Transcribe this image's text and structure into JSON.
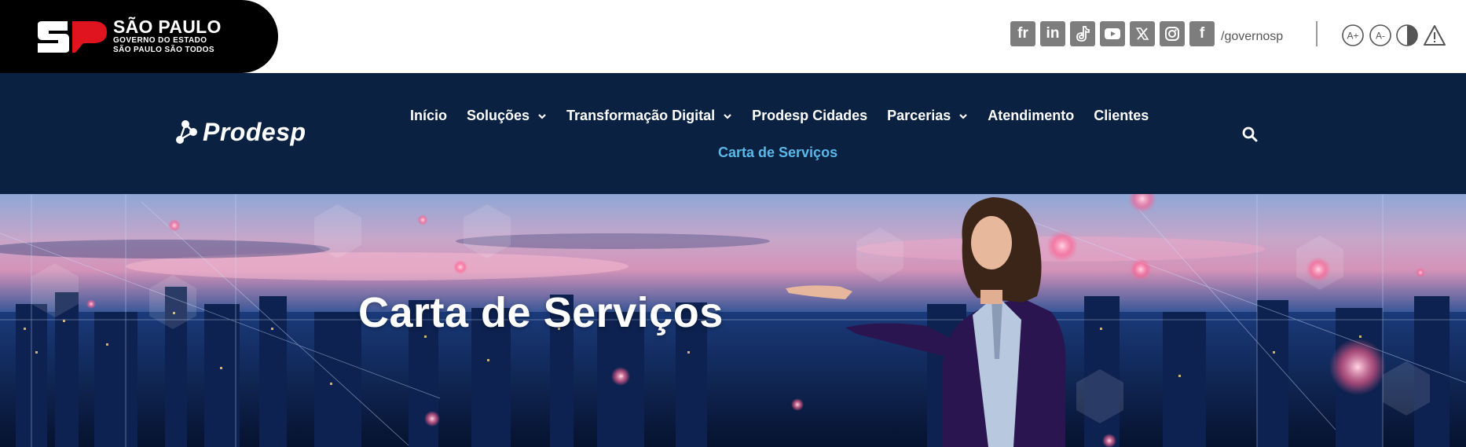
{
  "gov": {
    "title": "SÃO PAULO",
    "line2": "GOVERNO DO ESTADO",
    "line3": "SÃO PAULO SÃO TODOS",
    "brand_red": "#e0141e"
  },
  "social": {
    "icons": [
      "flickr-icon",
      "linkedin-icon",
      "tiktok-icon",
      "youtube-icon",
      "x-icon",
      "instagram-icon",
      "facebook-icon"
    ],
    "flickr_label": "fr",
    "linkedin_label": "in",
    "facebook_label": "f",
    "handle": "/governosp"
  },
  "accessibility": {
    "icons": [
      "increase-font-icon",
      "decrease-font-icon",
      "contrast-icon",
      "alert-icon"
    ]
  },
  "nav": {
    "brand": "Prodesp",
    "items": [
      {
        "label": "Início",
        "dropdown": false
      },
      {
        "label": "Soluções",
        "dropdown": true
      },
      {
        "label": "Transformação Digital",
        "dropdown": true
      },
      {
        "label": "Prodesp Cidades",
        "dropdown": false
      },
      {
        "label": "Parcerias",
        "dropdown": true
      },
      {
        "label": "Atendimento",
        "dropdown": false
      },
      {
        "label": "Clientes",
        "dropdown": false
      }
    ],
    "active": "Carta de Serviços",
    "bg": "#0a2141",
    "active_color": "#5bb8e8"
  },
  "hero": {
    "title": "Carta de Serviços"
  }
}
